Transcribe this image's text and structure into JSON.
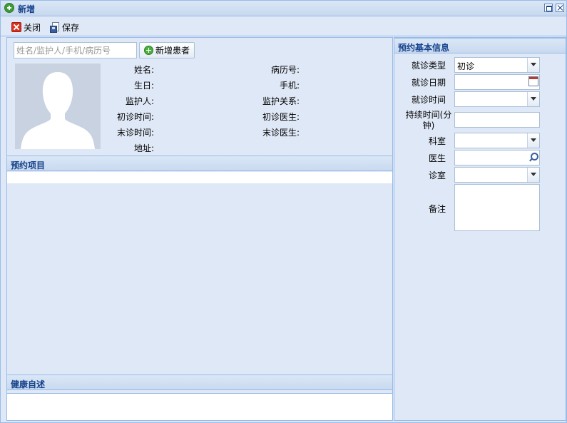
{
  "window": {
    "title": "新增"
  },
  "toolbar": {
    "close_label": "关闭",
    "save_label": "保存"
  },
  "patient": {
    "search_placeholder": "姓名/监护人/手机/病历号",
    "add_button_label": "新增患者",
    "fields_left": [
      "姓名:",
      "生日:",
      "监护人:",
      "初诊时间:",
      "末诊时间:",
      "地址:"
    ],
    "fields_right": [
      "病历号:",
      "手机:",
      "监护关系:",
      "初诊医生:",
      "末诊医生:"
    ]
  },
  "sections": {
    "appointment_items": "预约项目",
    "health_statement": "健康自述",
    "appointment_info": "预约基本信息"
  },
  "form": {
    "visit_type_label": "就诊类型",
    "visit_type_value": "初诊",
    "visit_date_label": "就诊日期",
    "visit_time_label": "就诊时间",
    "duration_label": "持续时间(分钟)",
    "department_label": "科室",
    "doctor_label": "医生",
    "room_label": "诊室",
    "remark_label": "备注"
  },
  "colors": {
    "header_text": "#15428b",
    "panel_bg": "#dfe8f6",
    "border": "#99bbe8"
  }
}
